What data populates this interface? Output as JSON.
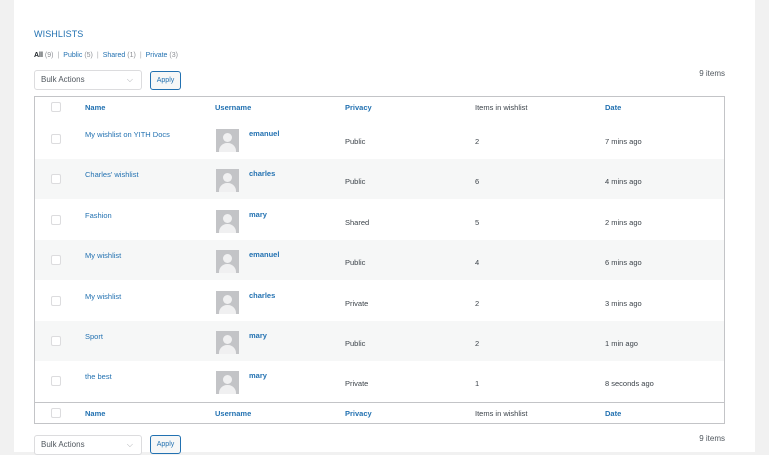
{
  "page": {
    "title": "WISHLISTS",
    "filters": [
      {
        "label": "All",
        "count": "(9)",
        "current": true
      },
      {
        "label": "Public",
        "count": "(5)",
        "current": false
      },
      {
        "label": "Shared",
        "count": "(1)",
        "current": false
      },
      {
        "label": "Private",
        "count": "(3)",
        "current": false
      }
    ],
    "bulk_actions": "Bulk Actions",
    "apply": "Apply",
    "items_count": "9 items"
  },
  "table": {
    "columns": {
      "name": "Name",
      "username": "Username",
      "privacy": "Privacy",
      "items": "Items in wishlist",
      "date": "Date"
    },
    "rows": [
      {
        "name": "My wishlist on YITH Docs",
        "username": "emanuel",
        "privacy": "Public",
        "items": "2",
        "date": "7 mins ago"
      },
      {
        "name": "Charles' wishlist",
        "username": "charles",
        "privacy": "Public",
        "items": "6",
        "date": "4 mins ago"
      },
      {
        "name": "Fashion",
        "username": "mary",
        "privacy": "Shared",
        "items": "5",
        "date": "2 mins ago"
      },
      {
        "name": "My wishlist",
        "username": "emanuel",
        "privacy": "Public",
        "items": "4",
        "date": "6 mins ago"
      },
      {
        "name": "My wishlist",
        "username": "charles",
        "privacy": "Private",
        "items": "2",
        "date": "3 mins ago"
      },
      {
        "name": "Sport",
        "username": "mary",
        "privacy": "Public",
        "items": "2",
        "date": "1 min ago"
      },
      {
        "name": "the best",
        "username": "mary",
        "privacy": "Private",
        "items": "1",
        "date": "8 seconds ago"
      }
    ]
  },
  "icons": {
    "avatar": "user-avatar-placeholder",
    "chevron": "chevron-down-icon"
  }
}
